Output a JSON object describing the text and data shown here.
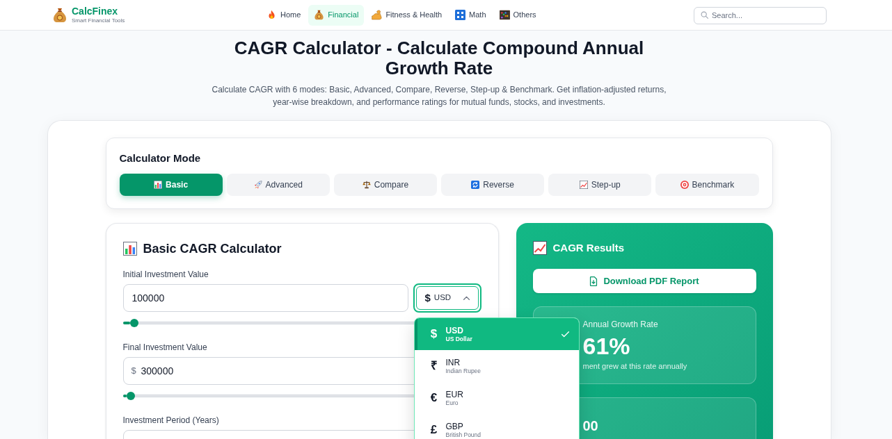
{
  "header": {
    "logo": {
      "name": "CalcFinex",
      "tagline": "Smart Financial Tools"
    },
    "nav": [
      {
        "label": "Home",
        "selected": false
      },
      {
        "label": "Financial",
        "selected": true
      },
      {
        "label": "Fitness & Health",
        "selected": false
      },
      {
        "label": "Math",
        "selected": false
      },
      {
        "label": "Others",
        "selected": false
      }
    ],
    "search": {
      "placeholder": "Search..."
    }
  },
  "hero": {
    "title": "CAGR Calculator - Calculate Compound Annual Growth Rate",
    "subtitle": "Calculate CAGR with 6 modes: Basic, Advanced, Compare, Reverse, Step-up & Benchmark. Get inflation-adjusted returns, year-wise breakdown, and performance ratings for mutual funds, stocks, and investments."
  },
  "mode_panel": {
    "title": "Calculator Mode",
    "modes": [
      {
        "label": "Basic",
        "selected": true
      },
      {
        "label": "Advanced",
        "selected": false
      },
      {
        "label": "Compare",
        "selected": false
      },
      {
        "label": "Reverse",
        "selected": false
      },
      {
        "label": "Step-up",
        "selected": false
      },
      {
        "label": "Benchmark",
        "selected": false
      }
    ]
  },
  "calculator": {
    "title": "Basic CAGR Calculator",
    "fields": [
      {
        "label": "Initial Investment Value",
        "value": "100000",
        "currency": {
          "symbol": "$",
          "code": "USD",
          "expanded": true,
          "options": [
            {
              "symbol": "$",
              "code": "USD",
              "name": "US Dollar",
              "selected": true
            },
            {
              "symbol": "₹",
              "code": "INR",
              "name": "Indian Rupee",
              "selected": false
            },
            {
              "symbol": "€",
              "code": "EUR",
              "name": "Euro",
              "selected": false
            },
            {
              "symbol": "£",
              "code": "GBP",
              "name": "British Pound",
              "selected": false
            }
          ]
        },
        "slider": {
          "level": 0.02
        }
      },
      {
        "label": "Final Investment Value",
        "prefix": "$",
        "value": "300000",
        "slider": {
          "level": 0.01
        }
      },
      {
        "label": "Investment Period (Years)"
      }
    ]
  },
  "results": {
    "title": "CAGR Results",
    "download_button": "Download PDF Report",
    "cards": [
      {
        "label": "Annual Growth Rate",
        "value": "61%",
        "note": "ment grew at this rate annually"
      },
      {
        "value": "00"
      }
    ]
  }
}
